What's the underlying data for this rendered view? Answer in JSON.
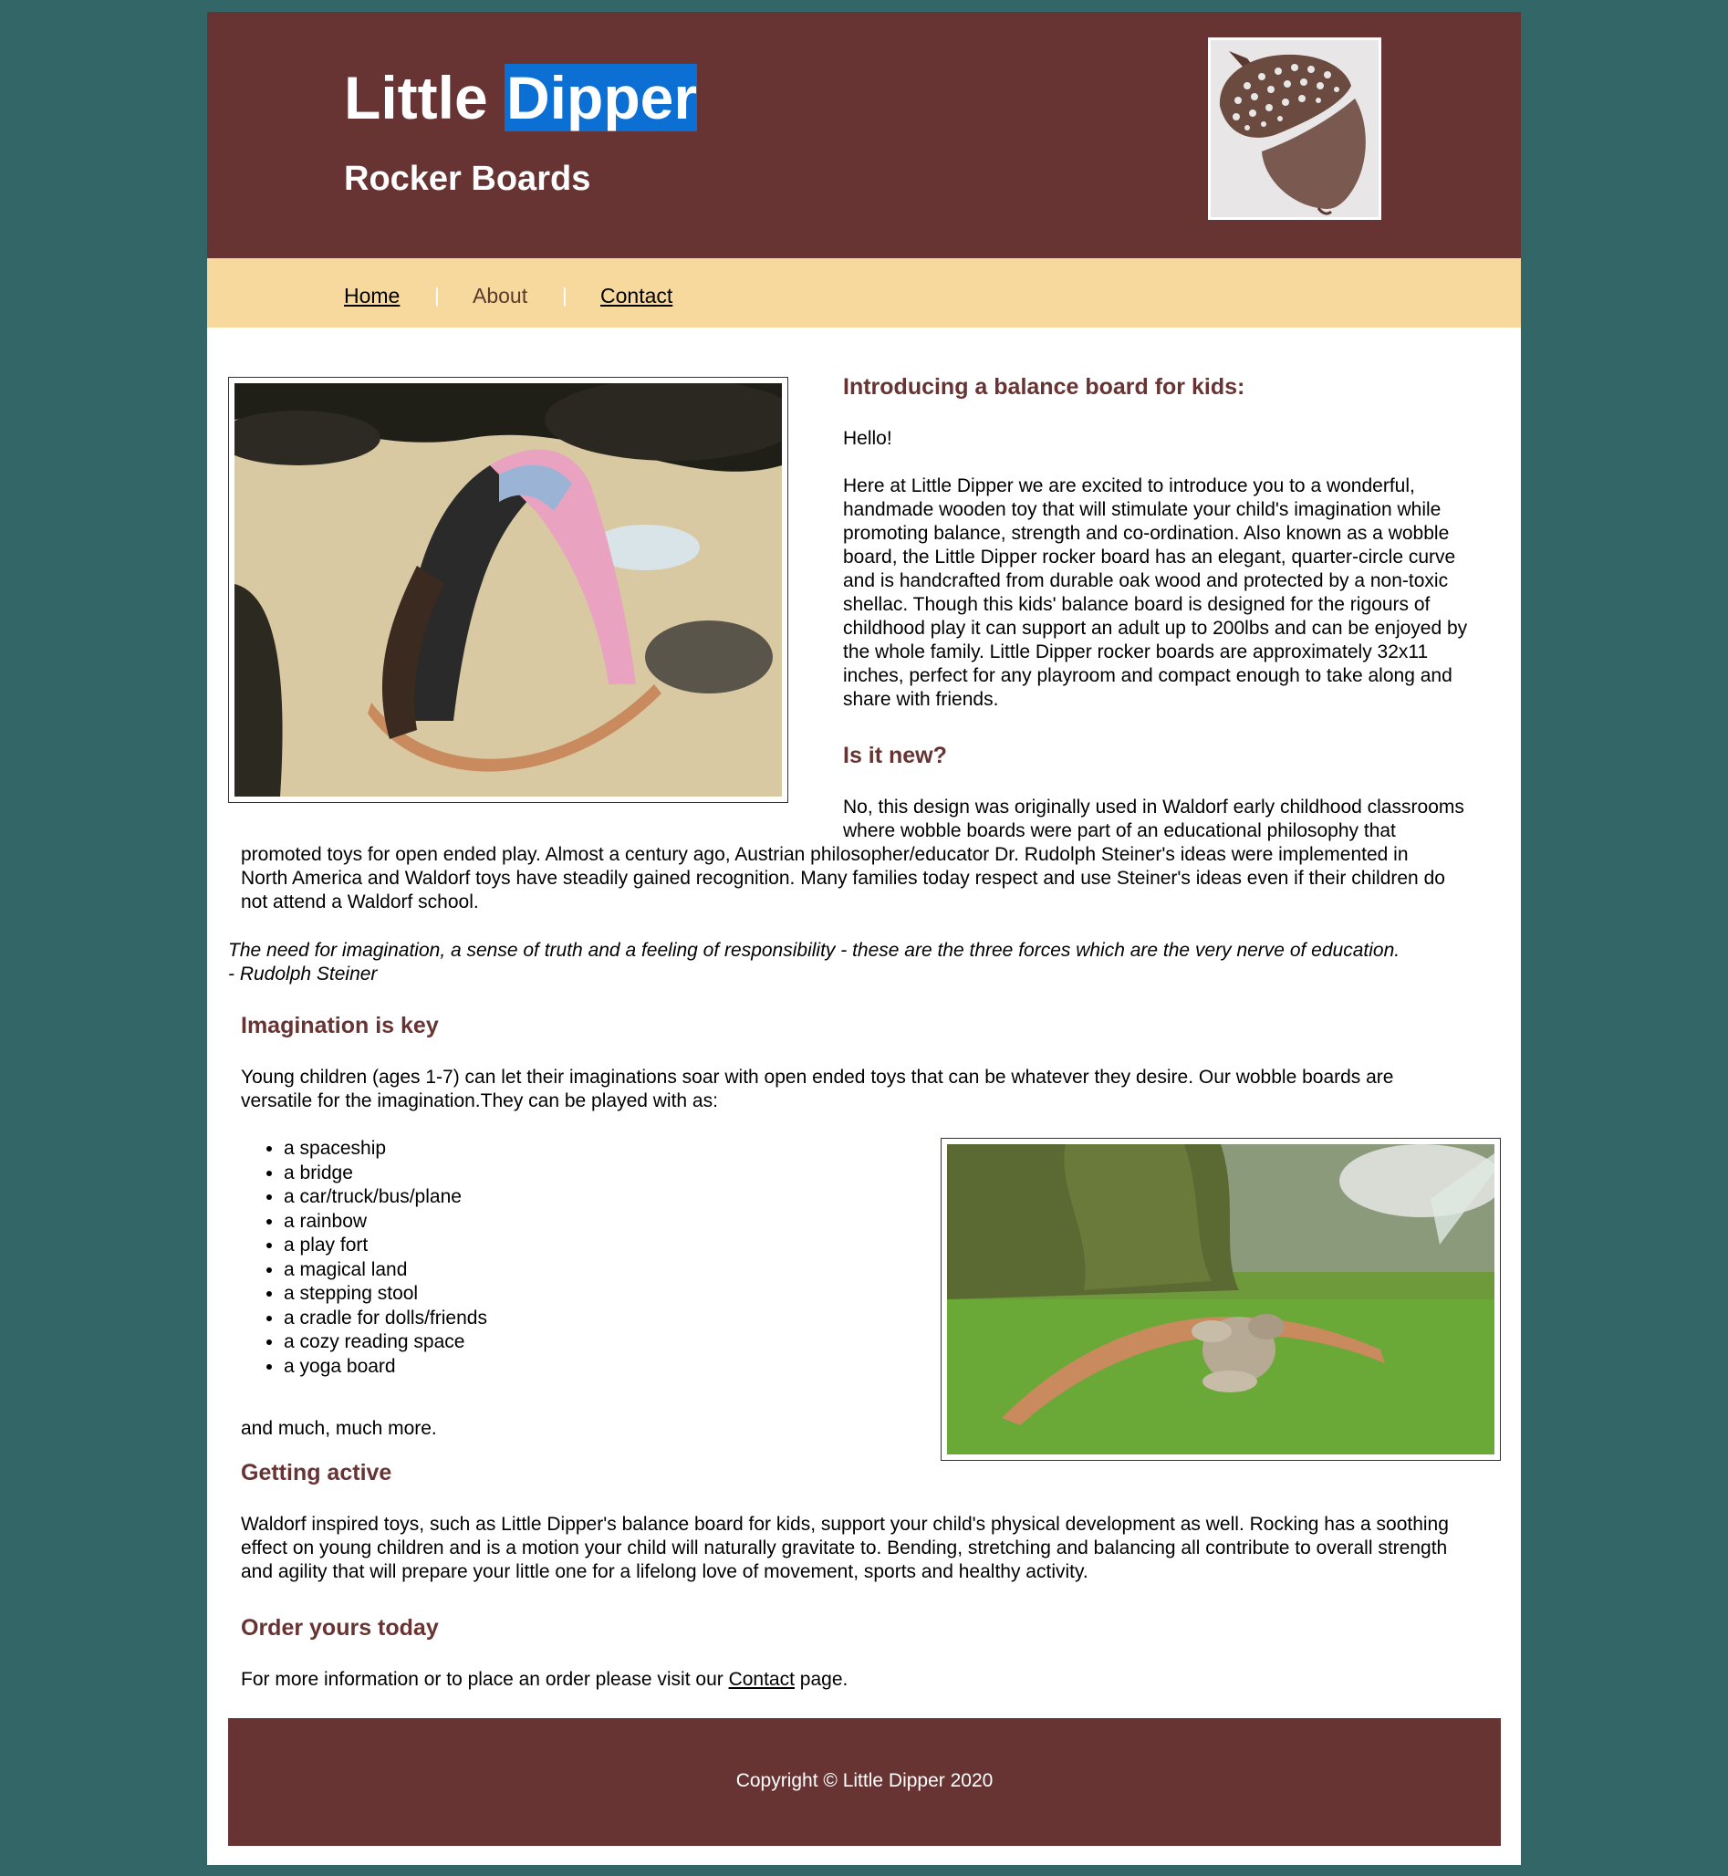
{
  "header": {
    "title_part1": "Little ",
    "title_part2": "Dipper",
    "subtitle": "Rocker Boards",
    "logo_icon": "acorn-logo"
  },
  "nav": {
    "items": [
      {
        "label": "Home"
      },
      {
        "label": "About"
      },
      {
        "label": "Contact"
      }
    ],
    "separator": "|"
  },
  "intro": {
    "heading": "Introducing a balance board for kids:",
    "greeting": "Hello!",
    "lines": [
      "Here at Little Dipper we are excited to introduce you to a wonderful,",
      "handmade wooden toy that will stimulate your child's imagination while",
      "promoting balance, strength and co-ordination. Also known as a wobble",
      "board, the Little Dipper rocker board has an elegant, quarter-circle curve",
      "and is handcrafted from durable oak wood and protected by a non-toxic",
      "shellac. Though this kids' balance board is designed for the rigours of",
      "childhood play it can support an adult up to 200lbs and can be enjoyed by",
      "the whole family. Little Dipper rocker boards are approximately 32x11",
      "inches, perfect for any playroom and compact enough to take along and",
      "share with friends."
    ]
  },
  "new_section": {
    "heading": "Is it new?",
    "lines": [
      "No, this design was originally used in Waldorf early childhood classrooms",
      "where wobble boards were part of an educational philosophy that",
      "promoted toys for open ended play. Almost a century ago, Austrian philosopher/educator Dr. Rudolph Steiner's ideas were implemented in",
      "North America and Waldorf toys have steadily gained recognition. Many families today respect and use Steiner's ideas even if their children do",
      "not attend a Waldorf school."
    ]
  },
  "quote": {
    "text": "The need for imagination, a sense of truth and a feeling of responsibility - these are the three forces which are the very nerve of education.",
    "attribution": "- Rudolph Steiner"
  },
  "imagination": {
    "heading": "Imagination is key",
    "lines": [
      "Young children (ages 1-7) can let their imaginations soar with open ended toys that can be whatever they desire. Our wobble boards are",
      "versatile for the imagination.They can be played with as:"
    ],
    "items": [
      "a spaceship",
      "a bridge",
      "a car/truck/bus/plane",
      "a rainbow",
      "a play fort",
      "a magical land",
      "a stepping stool",
      "a cradle for dolls/friends",
      "a cozy reading space",
      "a yoga board"
    ],
    "closing": "and much, much more."
  },
  "active": {
    "heading": "Getting active",
    "lines": [
      "Waldorf inspired toys, such as Little Dipper's balance board for kids, support your child's physical development as well. Rocking has a soothing",
      "effect on young children and is a motion your child will naturally gravitate to. Bending, stretching and balancing all contribute to overall strength",
      "and agility that will prepare your little one for a lifelong love of movement, sports and healthy activity."
    ]
  },
  "order": {
    "heading": "Order yours today",
    "text_before": "For more information or to place an order please visit our ",
    "link": "Contact",
    "text_after": " page."
  },
  "footer": {
    "copyright": "Copyright © Little Dipper 2020"
  },
  "colors": {
    "background": "#336666",
    "brand_dark": "#683333",
    "nav_bar": "#f7d89d",
    "highlight": "#0b6fd3"
  }
}
